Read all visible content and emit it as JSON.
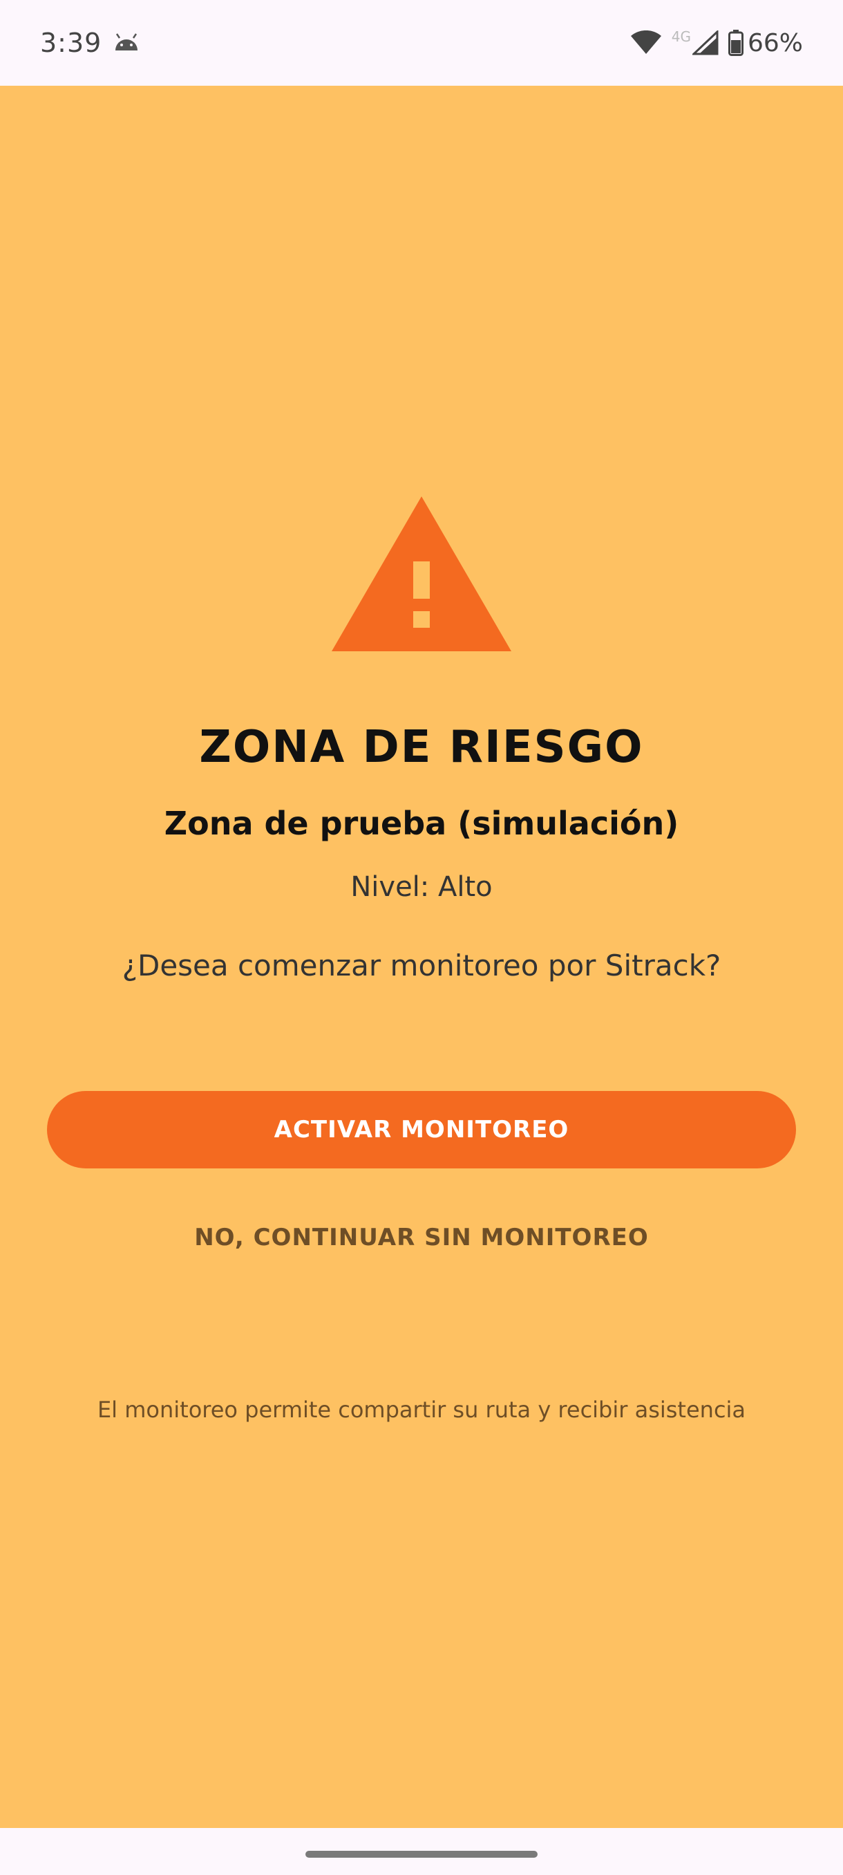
{
  "status_bar": {
    "time": "3:39",
    "network_label": "4G",
    "battery": "66%",
    "icons": [
      "android-icon",
      "wifi-icon",
      "signal-icon",
      "battery-icon"
    ]
  },
  "alert": {
    "icon": "warning-triangle-icon",
    "title": "ZONA DE RIESGO",
    "zone_name": "Zona de prueba (simulación)",
    "level": "Nivel: Alto",
    "question": "¿Desea comenzar monitoreo por Sitrack?",
    "primary_button": "ACTIVAR MONITOREO",
    "secondary_button": "NO, CONTINUAR SIN MONITOREO",
    "footnote": "El monitoreo permite compartir su ruta y recibir asistencia"
  },
  "colors": {
    "background": "#fec162",
    "accent": "#f46a20",
    "secondary_text": "#6e4e26",
    "system_bar": "#fdf7fd"
  }
}
